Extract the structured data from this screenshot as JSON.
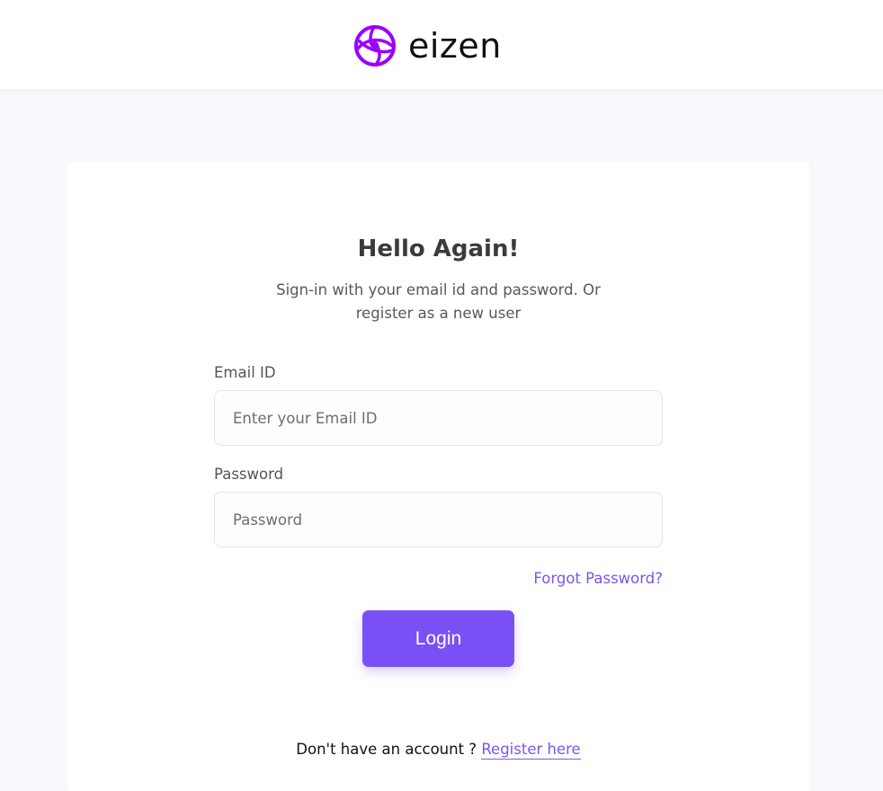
{
  "brand": {
    "logo_icon": "eizen-eye-icon",
    "name": "eizen",
    "color": "#9b00ff"
  },
  "login": {
    "title": "Hello Again!",
    "subtitle_line1": "Sign-in with your email id and password. Or",
    "subtitle_line2": "register as a new user",
    "email_label": "Email ID",
    "email_placeholder": "Enter your Email ID",
    "email_value": "",
    "password_label": "Password",
    "password_placeholder": "Password",
    "password_value": "",
    "forgot_label": "Forgot Password?",
    "login_label": "Login",
    "no_account_text": "Don't have an account ?",
    "register_label": "Register here"
  },
  "colors": {
    "accent": "#7950f6",
    "link": "#7b55f0",
    "background": "#f8f8fd"
  }
}
